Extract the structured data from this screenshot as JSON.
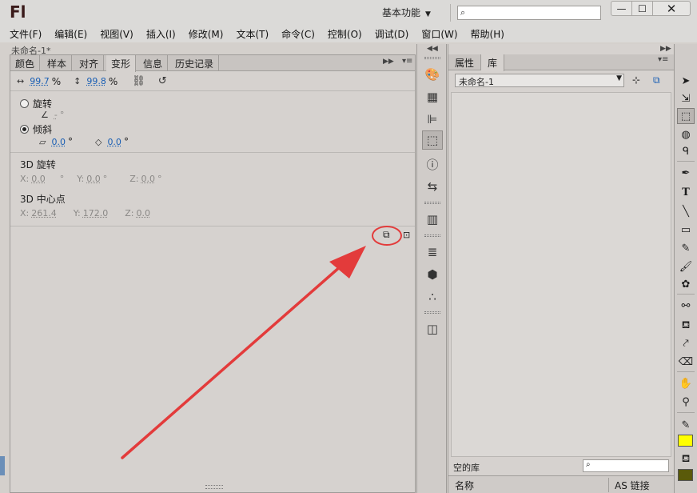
{
  "app": {
    "logo": "Fl",
    "workspace_label": "基本功能",
    "search_placeholder": "",
    "window_controls": {
      "minimize": "—",
      "maximize": "☐",
      "close": "✕"
    }
  },
  "menu": [
    "文件(F)",
    "编辑(E)",
    "视图(V)",
    "插入(I)",
    "修改(M)",
    "文本(T)",
    "命令(C)",
    "控制(O)",
    "调试(D)",
    "窗口(W)",
    "帮助(H)"
  ],
  "document_tab_stub": "未命名-1*",
  "transform_panel": {
    "tabs": [
      "颜色",
      "样本",
      "对齐",
      "变形",
      "信息",
      "历史记录"
    ],
    "active_tab": "变形",
    "scale_width": "99.7",
    "scale_height": "99.8",
    "percent": "%",
    "rotate_label": "旋转",
    "rotate_value": "-",
    "rotate_unit": "°",
    "skew_label": "倾斜",
    "skew_h": "0.0",
    "skew_v": "0.0",
    "deg": "°",
    "rot3d_label": "3D 旋转",
    "rot3d_x": "0.0",
    "rot3d_y": "0.0",
    "rot3d_z": "0.0",
    "center3d_label": "3D 中心点",
    "center3d_x": "261.4",
    "center3d_y": "172.0",
    "center3d_z": "0.0",
    "axis_x": "X:",
    "axis_y": "Y:",
    "axis_z": "Z:",
    "rotate_selected": true
  },
  "library_panel": {
    "tabs": [
      "属性",
      "库"
    ],
    "active_tab": "库",
    "document_select": "未命名-1",
    "empty_label": "空的库",
    "columns": {
      "name": "名称",
      "linkage": "AS 链接"
    }
  },
  "colors": {
    "annotation_red": "#e33b3b",
    "stroke_color": "#ffff00",
    "fill_color": "#5a5a0a",
    "value_blue": "#1a5fb4"
  }
}
